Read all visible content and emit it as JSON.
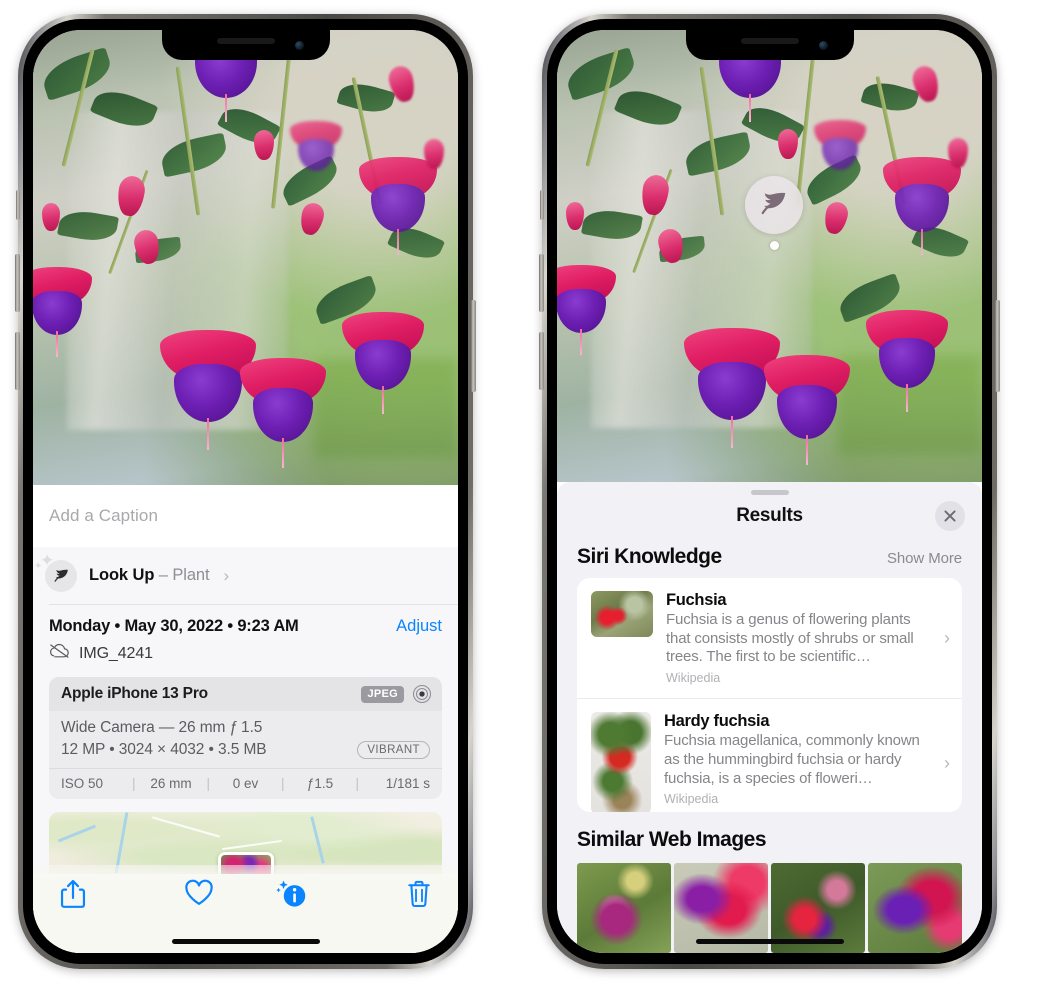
{
  "left_phone": {
    "name": "photos-info-screen",
    "caption_field": {
      "placeholder": "Add a Caption",
      "value": ""
    },
    "look_up": {
      "label": "Look Up",
      "dash": " – ",
      "kind": "Plant",
      "chevron": "›",
      "icon": "leaf-icon"
    },
    "metadata": {
      "date": "Monday • May 30, 2022 • 9:23 AM",
      "adjust_label": "Adjust",
      "filename": "IMG_4241",
      "cloud_icon": "icloud-slash-icon"
    },
    "exif": {
      "device": "Apple iPhone 13 Pro",
      "format_badge": "JPEG",
      "raw_icon": "raw-target-icon",
      "lens_line": "Wide Camera — 26 mm ƒ 1.5",
      "size_line": "12 MP • 3024 × 4032 • 3.5 MB",
      "style_badge": "VIBRANT",
      "stats": [
        "ISO 50",
        "26 mm",
        "0 ev",
        "ƒ1.5",
        "1/181 s"
      ]
    },
    "map": {
      "name": "location-map-card"
    },
    "toolbar": [
      {
        "name": "share-button",
        "icon": "share-icon"
      },
      {
        "name": "favorite-button",
        "icon": "heart-icon"
      },
      {
        "name": "info-button",
        "icon": "info-sparkle-icon"
      },
      {
        "name": "delete-button",
        "icon": "trash-icon"
      }
    ]
  },
  "right_phone": {
    "name": "visual-look-up-results-screen",
    "vlu_badge": {
      "icon": "leaf-icon"
    },
    "sheet": {
      "title": "Results",
      "close_icon": "close-icon",
      "sections": [
        {
          "heading": "Siri Knowledge",
          "action": "Show More",
          "cards": [
            {
              "title": "Fuchsia",
              "description": "Fuchsia is a genus of flowering plants that consists mostly of shrubs or small trees. The first to be scientific…",
              "source": "Wikipedia",
              "chevron": "›"
            },
            {
              "title": "Hardy fuchsia",
              "description": "Fuchsia magellanica, commonly known as the hummingbird fuchsia or hardy fuchsia, is a species of floweri…",
              "source": "Wikipedia",
              "chevron": "›"
            }
          ]
        },
        {
          "heading": "Similar Web Images",
          "images": [
            "web-image-1",
            "web-image-2",
            "web-image-3",
            "web-image-4"
          ]
        }
      ]
    }
  },
  "colors": {
    "accent_blue": "#0a84ff",
    "sheet_bg": "#f2f1f6",
    "card_bg": "#ffffff",
    "secondary_text": "#8e8e93",
    "toolbar_bg": "#f7f8f1"
  }
}
